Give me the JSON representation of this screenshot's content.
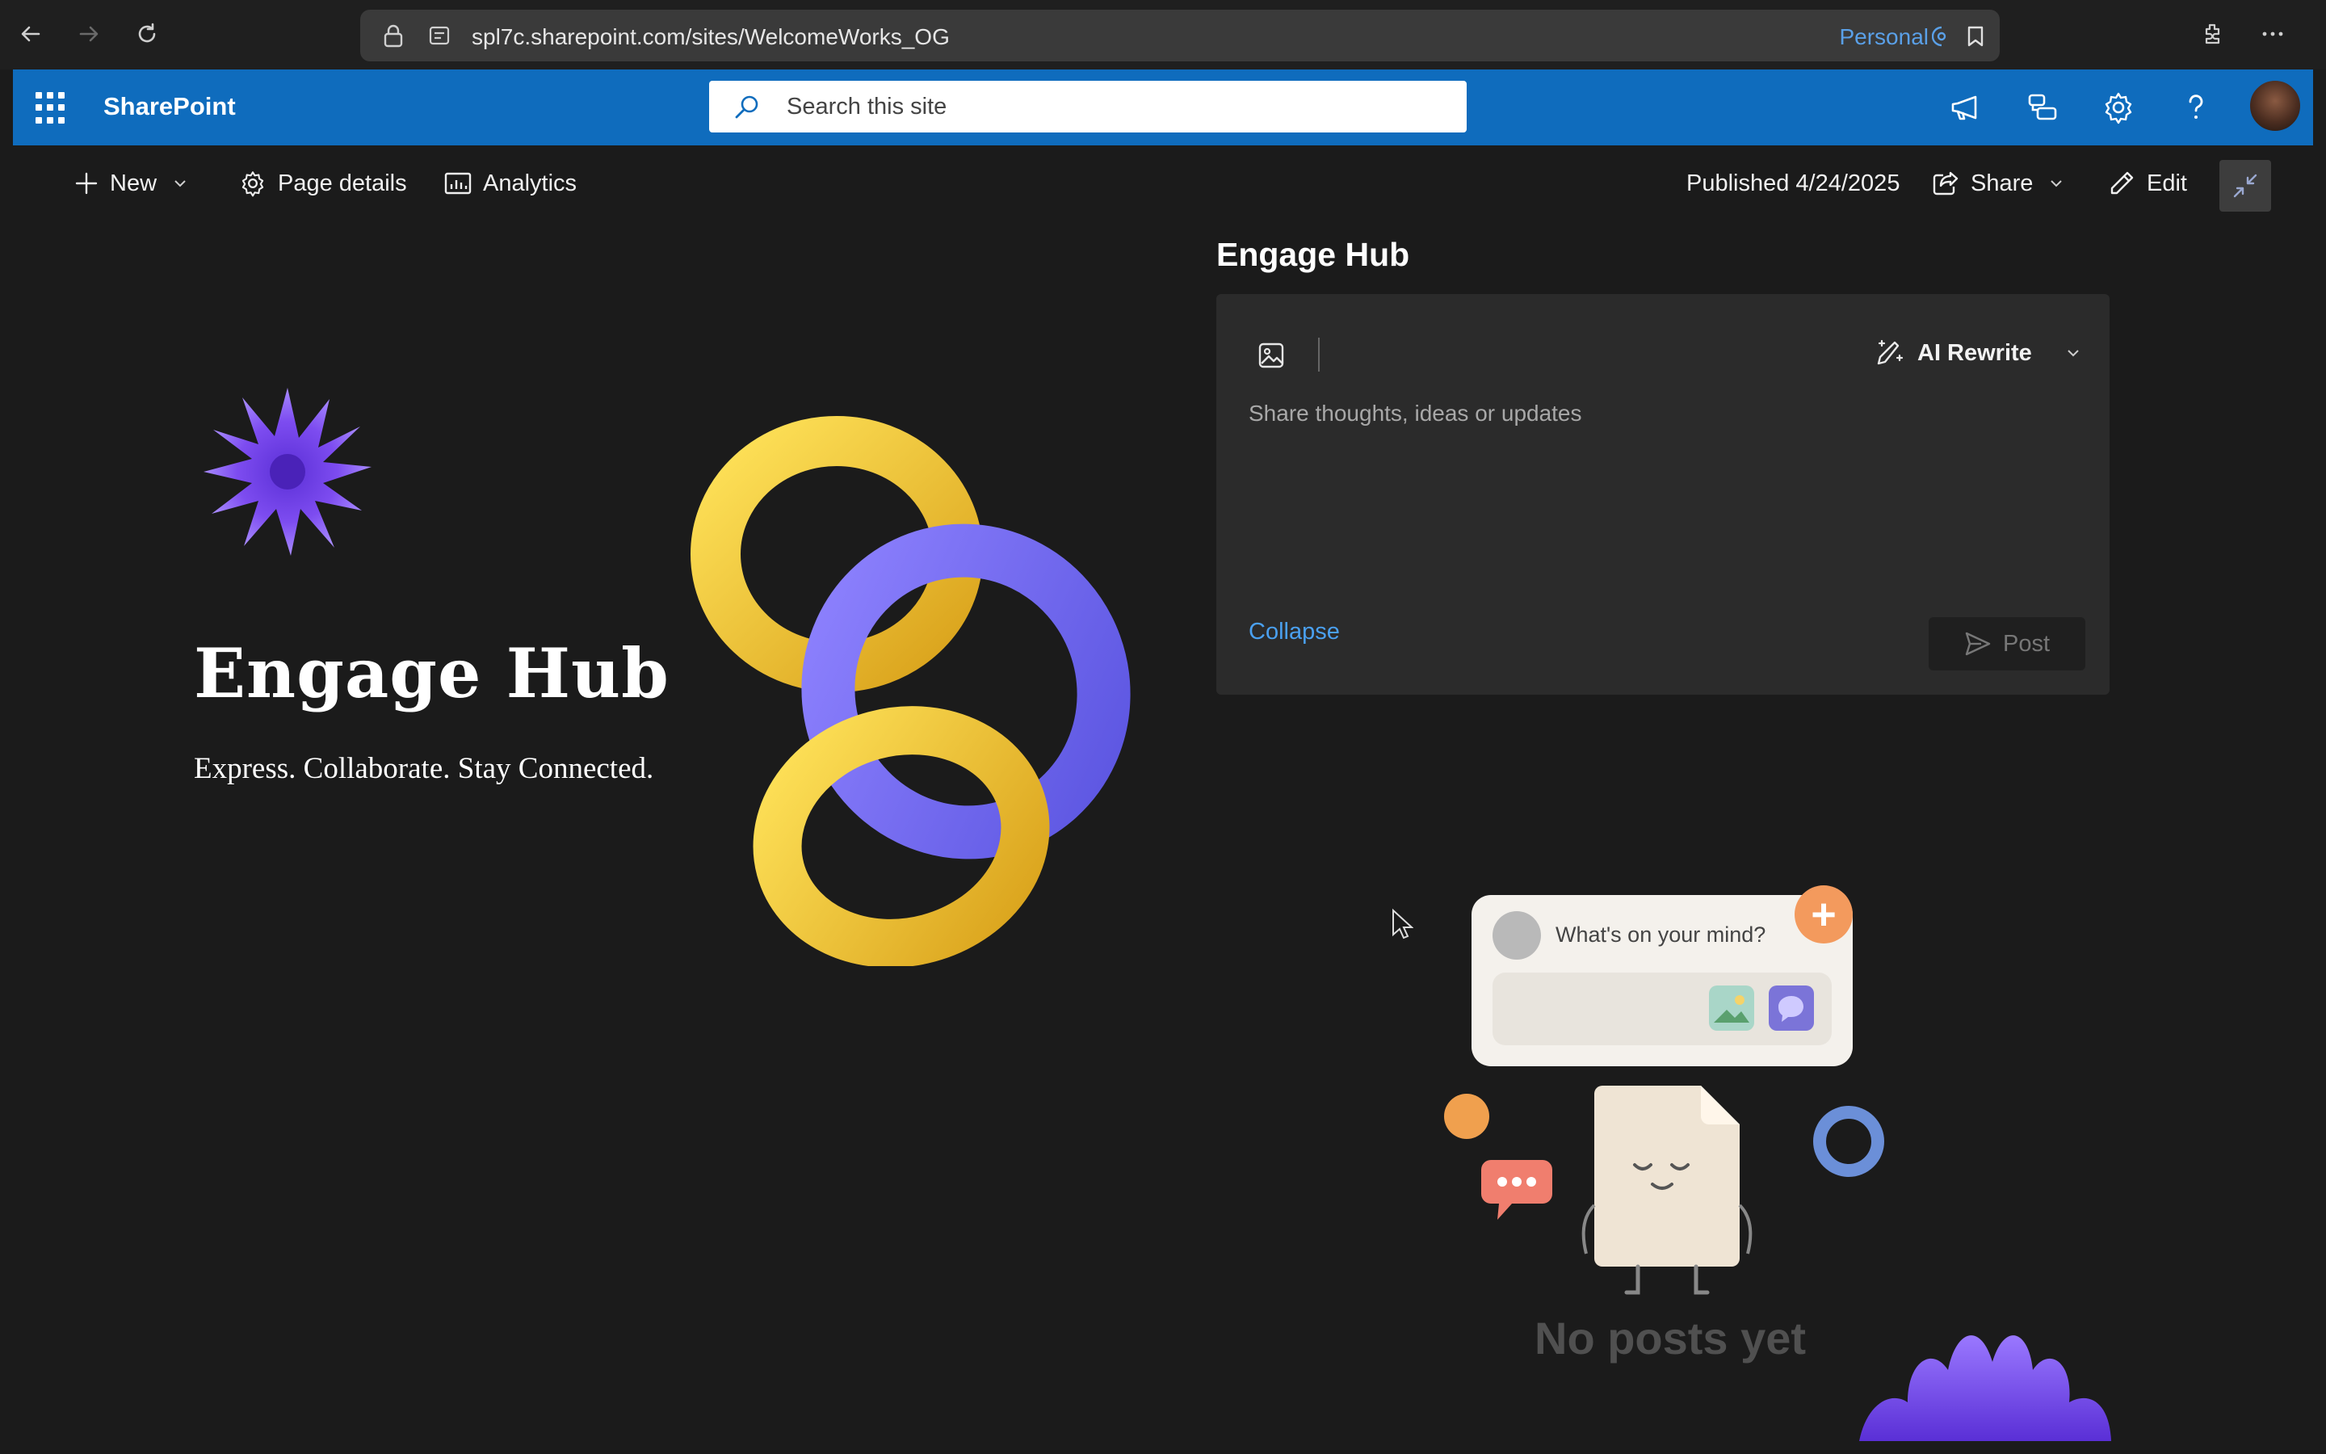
{
  "browser": {
    "url": "spl7c.sharepoint.com/sites/WelcomeWorks_OG",
    "profile_label": "Personal"
  },
  "suitebar": {
    "app_name": "SharePoint",
    "search_placeholder": "Search this site"
  },
  "commandbar": {
    "new_label": "New",
    "page_details_label": "Page details",
    "analytics_label": "Analytics",
    "published_label": "Published 4/24/2025",
    "share_label": "Share",
    "edit_label": "Edit"
  },
  "hero": {
    "title": "Engage Hub",
    "subtitle": "Express. Collaborate. Stay Connected."
  },
  "engage": {
    "title": "Engage Hub",
    "ai_rewrite_label": "AI Rewrite",
    "composer_placeholder": "Share thoughts, ideas or updates",
    "collapse_label": "Collapse",
    "post_label": "Post",
    "illustration_prompt": "What's on your mind?",
    "empty_state": "No posts yet"
  },
  "colors": {
    "suitebar": "#0f6cbd",
    "background": "#1b1b1b",
    "link": "#4aa0f0"
  }
}
